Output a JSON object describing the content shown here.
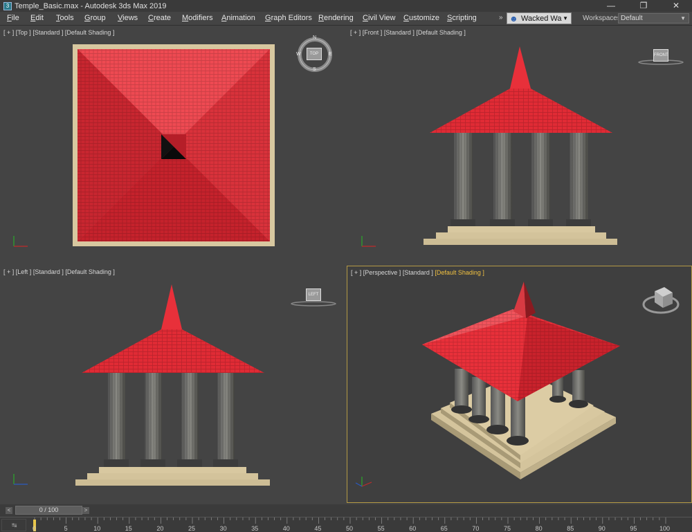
{
  "window": {
    "title": "Temple_Basic.max - Autodesk 3ds Max 2019",
    "minimize_glyph": "—",
    "maximize_glyph": "❐",
    "close_glyph": "✕"
  },
  "menu": {
    "items": [
      "File",
      "Edit",
      "Tools",
      "Group",
      "Views",
      "Create",
      "Modifiers",
      "Animation",
      "Graph Editors",
      "Rendering",
      "Civil View",
      "Customize",
      "Scripting"
    ],
    "more_glyph": "»",
    "user_name": "Wacked Wa",
    "workspaces_label": "Workspaces:",
    "workspace_value": "Default"
  },
  "viewports": {
    "top": {
      "parts": [
        "[ + ]",
        "[Top ]",
        "[Standard ]",
        "[Default Shading ]"
      ],
      "cube_label": "TOP",
      "compass": {
        "n": "N",
        "s": "S",
        "e": "E",
        "w": "W"
      }
    },
    "front": {
      "parts": [
        "[ + ]",
        "[Front ]",
        "[Standard ]",
        "[Default Shading ]"
      ],
      "cube_label": "FRONT"
    },
    "left": {
      "parts": [
        "[ + ]",
        "[Left ]",
        "[Standard ]",
        "[Default Shading ]"
      ],
      "cube_label": "LEFT"
    },
    "perspective": {
      "parts": [
        "[ + ]",
        "[Perspective ]",
        "[Standard ]",
        "[Default Shading ]"
      ],
      "active": true
    }
  },
  "timeline": {
    "frame_display": "0 / 100",
    "prev_glyph": "<",
    "next_glyph": ">",
    "ruler_ticks": [
      "0",
      "5",
      "10",
      "15",
      "20",
      "25",
      "30",
      "35",
      "40",
      "45",
      "50",
      "55",
      "60",
      "65",
      "70",
      "75",
      "80",
      "85",
      "90",
      "95",
      "100"
    ],
    "current_frame": 0
  },
  "colors": {
    "roof_red": "#e8303a",
    "column_gray": "#6e6e68",
    "base_tan": "#d8c8a0",
    "active_viewport_border": "#b59a45"
  }
}
